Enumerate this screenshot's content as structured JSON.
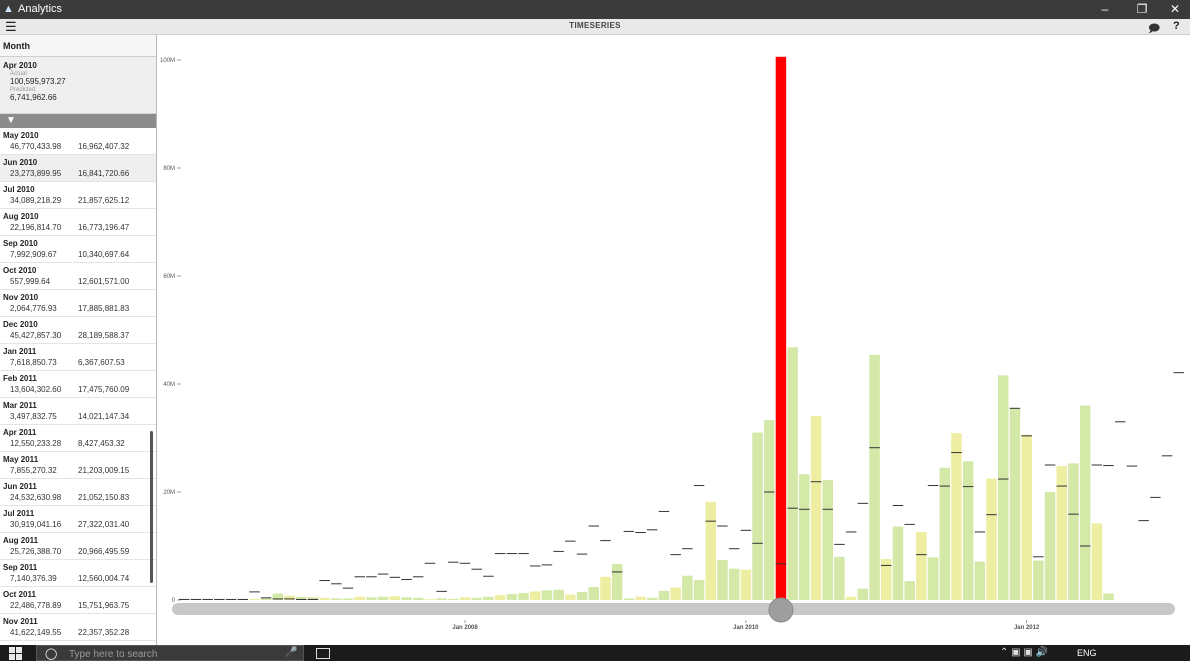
{
  "window": {
    "app_title": "Analytics",
    "view_title": "TIMESERIES"
  },
  "sidebar": {
    "header": "Month",
    "selected": {
      "month": "Apr 2010",
      "actual_caption": "Actual",
      "actual": "100,595,973.27",
      "predicted_caption": "Predicted",
      "predicted": "6,741,962.66"
    },
    "rows": [
      {
        "month": "May 2010",
        "actual": "46,770,433.98",
        "predicted": "16,962,407.32"
      },
      {
        "month": "Jun 2010",
        "actual": "23,273,899.95",
        "predicted": "16,841,720.66"
      },
      {
        "month": "Jul 2010",
        "actual": "34,089,218.29",
        "predicted": "21,857,625.12"
      },
      {
        "month": "Aug 2010",
        "actual": "22,196,814.70",
        "predicted": "16,773,196.47"
      },
      {
        "month": "Sep 2010",
        "actual": "7,992,909.67",
        "predicted": "10,340,697.64"
      },
      {
        "month": "Oct 2010",
        "actual": "557,999.64",
        "predicted": "12,601,571.00"
      },
      {
        "month": "Nov 2010",
        "actual": "2,064,776.93",
        "predicted": "17,885,881.83"
      },
      {
        "month": "Dec 2010",
        "actual": "45,427,857.30",
        "predicted": "28,189,588.37"
      },
      {
        "month": "Jan 2011",
        "actual": "7,618,850.73",
        "predicted": "6,367,607.53"
      },
      {
        "month": "Feb 2011",
        "actual": "13,604,302.60",
        "predicted": "17,475,760.09"
      },
      {
        "month": "Mar 2011",
        "actual": "3,497,832.75",
        "predicted": "14,021,147.34"
      },
      {
        "month": "Apr 2011",
        "actual": "12,550,233.28",
        "predicted": "8,427,453.32"
      },
      {
        "month": "May 2011",
        "actual": "7,855,270.32",
        "predicted": "21,203,009.15"
      },
      {
        "month": "Jun 2011",
        "actual": "24,532,630.98",
        "predicted": "21,052,150.83"
      },
      {
        "month": "Jul 2011",
        "actual": "30,919,041.16",
        "predicted": "27,322,031.40"
      },
      {
        "month": "Aug 2011",
        "actual": "25,726,388.70",
        "predicted": "20,966,495.59"
      },
      {
        "month": "Sep 2011",
        "actual": "7,140,376.39",
        "predicted": "12,560,004.74"
      },
      {
        "month": "Oct 2011",
        "actual": "22,486,778.89",
        "predicted": "15,751,963.75"
      },
      {
        "month": "Nov 2011",
        "actual": "41,622,149.55",
        "predicted": "22,357,352.28"
      }
    ]
  },
  "taskbar": {
    "search_placeholder": "Type here to search",
    "language": "ENG"
  },
  "colors": {
    "selected_bar": "#ff0000",
    "bar_green": "#d4e8a8",
    "bar_yellow": "#eeeea2",
    "predicted_marker": "#333333"
  },
  "chart_data": {
    "type": "bar",
    "x_ticks": [
      "Jan 2008",
      "Jan 2010",
      "Jan 2012"
    ],
    "y_ticks": [
      "0",
      "20M",
      "40M",
      "60M",
      "80M",
      "100M"
    ],
    "ylim": [
      0,
      100000000
    ],
    "selected_month": "Apr 2010",
    "months": [
      "Jan 2006",
      "Feb 2006",
      "Mar 2006",
      "Apr 2006",
      "May 2006",
      "Jun 2006",
      "Jul 2006",
      "Aug 2006",
      "Sep 2006",
      "Oct 2006",
      "Nov 2006",
      "Dec 2006",
      "Jan 2007",
      "Feb 2007",
      "Mar 2007",
      "Apr 2007",
      "May 2007",
      "Jun 2007",
      "Jul 2007",
      "Aug 2007",
      "Sep 2007",
      "Oct 2007",
      "Nov 2007",
      "Dec 2007",
      "Jan 2008",
      "Feb 2008",
      "Mar 2008",
      "Apr 2008",
      "May 2008",
      "Jun 2008",
      "Jul 2008",
      "Aug 2008",
      "Sep 2008",
      "Oct 2008",
      "Nov 2008",
      "Dec 2008",
      "Jan 2009",
      "Feb 2009",
      "Mar 2009",
      "Apr 2009",
      "May 2009",
      "Jun 2009",
      "Jul 2009",
      "Aug 2009",
      "Sep 2009",
      "Oct 2009",
      "Nov 2009",
      "Dec 2009",
      "Jan 2010",
      "Feb 2010",
      "Mar 2010",
      "Apr 2010",
      "May 2010",
      "Jun 2010",
      "Jul 2010",
      "Aug 2010",
      "Sep 2010",
      "Oct 2010",
      "Nov 2010",
      "Dec 2010",
      "Jan 2011",
      "Feb 2011",
      "Mar 2011",
      "Apr 2011",
      "May 2011",
      "Jun 2011",
      "Jul 2011",
      "Aug 2011",
      "Sep 2011",
      "Oct 2011",
      "Nov 2011",
      "Dec 2011",
      "Jan 2012",
      "Feb 2012",
      "Mar 2012",
      "Apr 2012",
      "May 2012",
      "Jun 2012",
      "Jul 2012",
      "Aug 2012",
      "Sep 2012",
      "Oct 2012",
      "Nov 2012",
      "Dec 2012",
      "Jan 2013",
      "Feb 2013",
      "Mar 2013",
      "Apr 2013",
      "May 2013",
      "Jun 2013"
    ],
    "actual": [
      0.1,
      0.1,
      0.1,
      0.1,
      0.1,
      0.1,
      0.2,
      0.3,
      1.2,
      0.8,
      0.6,
      0.5,
      0.4,
      0.3,
      0.3,
      0.6,
      0.5,
      0.6,
      0.7,
      0.5,
      0.4,
      0.1,
      0.3,
      0.2,
      0.5,
      0.4,
      0.6,
      0.9,
      1.1,
      1.3,
      1.6,
      1.8,
      1.9,
      1.0,
      1.5,
      2.4,
      4.3,
      6.7,
      0.3,
      0.6,
      0.4,
      1.7,
      2.3,
      4.5,
      3.7,
      18.2,
      7.4,
      5.8,
      5.6,
      31.0,
      33.3,
      100.6,
      46.8,
      23.3,
      34.1,
      22.2,
      8.0,
      0.6,
      2.1,
      45.4,
      7.6,
      13.6,
      3.5,
      12.6,
      7.9,
      24.5,
      30.9,
      25.7,
      7.1,
      22.5,
      41.6,
      35.5,
      30.6,
      7.3,
      20.0,
      24.8,
      25.3,
      36.0,
      14.2,
      1.2,
      0,
      0,
      0,
      0,
      0,
      0,
      0,
      0,
      0,
      0
    ],
    "predicted": [
      0.1,
      0.1,
      0.1,
      0.1,
      0.1,
      0.1,
      1.5,
      0.4,
      0.2,
      0.2,
      0.1,
      0.1,
      3.6,
      3.0,
      2.2,
      4.3,
      4.3,
      4.8,
      4.2,
      3.8,
      4.3,
      6.8,
      1.6,
      7.0,
      6.8,
      5.7,
      4.4,
      8.6,
      8.6,
      8.6,
      6.3,
      6.5,
      9.0,
      10.9,
      8.5,
      13.7,
      11.0,
      5.2,
      12.7,
      12.5,
      13.0,
      16.4,
      8.4,
      9.5,
      21.2,
      14.6,
      13.7,
      9.5,
      12.9,
      10.5,
      20.0,
      6.7,
      17.0,
      16.8,
      21.9,
      16.8,
      10.3,
      12.6,
      17.9,
      28.2,
      6.4,
      17.5,
      14.0,
      8.4,
      21.2,
      21.1,
      27.3,
      21.0,
      12.6,
      15.8,
      22.4,
      35.5,
      30.4,
      8.0,
      25.0,
      21.1,
      15.9,
      10.0,
      25.0,
      24.9,
      33.0,
      24.8,
      14.7,
      19.0,
      26.7,
      42.1,
      0,
      0,
      0,
      0
    ]
  }
}
